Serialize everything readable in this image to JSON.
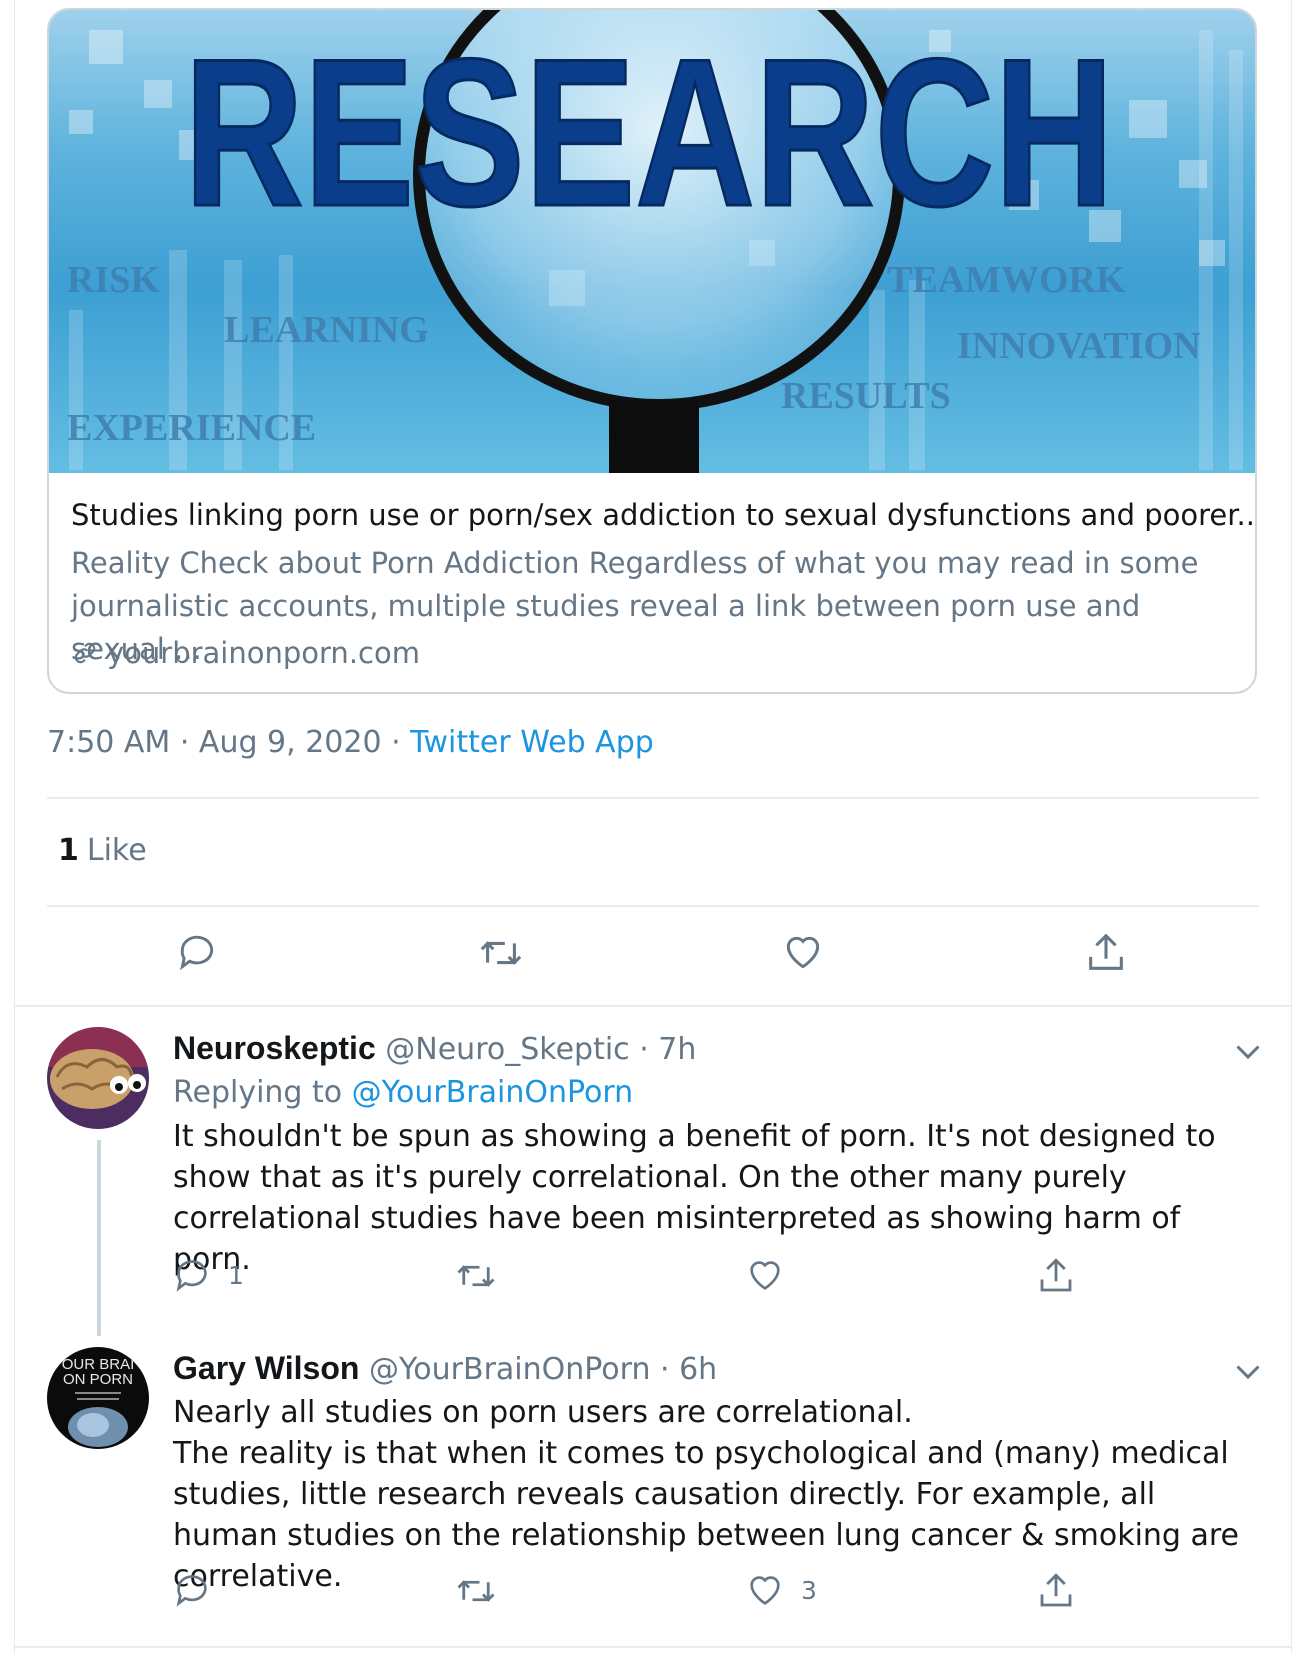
{
  "card": {
    "image_words": {
      "headline": "RESEARCH",
      "risk": "RISK",
      "learning": "LEARNING",
      "experience": "EXPERIENCE",
      "teamwork": "TEAMWORK",
      "innovation": "INNOVATION",
      "results": "RESULTS"
    },
    "title": "Studies linking porn use or porn/sex addiction to sexual dysfunctions and poorer...",
    "description": "Reality Check about Porn Addiction Regardless of what you may read in some journalistic accounts, multiple studies reveal a link between porn use and sexual ...",
    "domain": "yourbrainonporn.com"
  },
  "tweet_meta": {
    "time": "7:50 AM",
    "sep1": " · ",
    "date": "Aug 9, 2020",
    "sep2": " · ",
    "source": "Twitter Web App"
  },
  "stats": {
    "likes_count": "1",
    "likes_label": "Like"
  },
  "replies": [
    {
      "name": "Neuroskeptic",
      "handle": "@Neuro_Skeptic",
      "sep": " · ",
      "time": "7h",
      "replying_label": "Replying to ",
      "replying_to": "@YourBrainOnPorn",
      "text": "It shouldn't be spun as showing a benefit of porn. It's not designed to show that as it's purely correlational. On the other many purely correlational studies have been misinterpreted as showing harm of porn.",
      "reply_count": "1",
      "retweet_count": "",
      "like_count": ""
    },
    {
      "name": "Gary Wilson",
      "handle": "@YourBrainOnPorn",
      "sep": " · ",
      "time": "6h",
      "avatar_text_1": "OUR BRAI",
      "avatar_text_2": "ON PORN",
      "text_line1": "Nearly all studies on porn users are correlational.",
      "text_line2": "The reality is that when it comes to psychological and (many) medical studies, little research reveals causation directly. For example, all human studies on the relationship between lung cancer & smoking are correlative.",
      "reply_count": "",
      "retweet_count": "",
      "like_count": "3"
    }
  ],
  "colors": {
    "accent": "#1b95e0",
    "muted": "#657786",
    "text": "#14171a",
    "border": "#e6ecf0"
  }
}
